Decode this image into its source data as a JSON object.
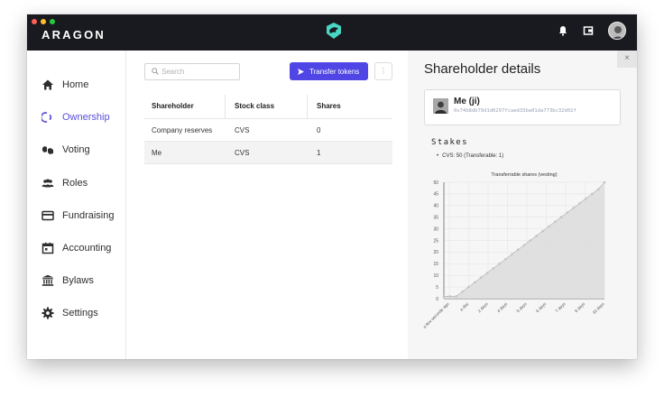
{
  "app": {
    "logo_text": "ARAGON",
    "traffic_colors": [
      "#ff5f56",
      "#ffbd2e",
      "#27c93f"
    ]
  },
  "sidebar": {
    "items": [
      {
        "label": "Home",
        "icon": "home-icon"
      },
      {
        "label": "Ownership",
        "icon": "ownership-icon",
        "active": true
      },
      {
        "label": "Voting",
        "icon": "voting-icon"
      },
      {
        "label": "Roles",
        "icon": "roles-icon"
      },
      {
        "label": "Fundraising",
        "icon": "fundraising-icon"
      },
      {
        "label": "Accounting",
        "icon": "accounting-icon"
      },
      {
        "label": "Bylaws",
        "icon": "bylaws-icon"
      },
      {
        "label": "Settings",
        "icon": "settings-icon"
      }
    ],
    "accent": "#5a4fd8"
  },
  "toolbar": {
    "search_placeholder": "Search",
    "transfer_label": "Transfer tokens",
    "more_label": "⋮"
  },
  "table": {
    "headers": [
      "Shareholder",
      "Stock class",
      "Shares"
    ],
    "rows": [
      [
        "Company reserves",
        "CVS",
        "0"
      ],
      [
        "Me",
        "CVS",
        "1"
      ]
    ]
  },
  "panel": {
    "title": "Shareholder details",
    "close_label": "×",
    "identity": {
      "name": "Me (ji)",
      "address": "0x74b8db79d1d0297fcaed33ba01da773bc32d02f"
    },
    "stakes_title": "Stakes",
    "stakes": [
      "CVS: 50 (Transferable: 1)"
    ]
  },
  "chart_data": {
    "type": "area",
    "title": "Transferrable shares (vesting)",
    "xlabel": "",
    "ylabel": "",
    "categories": [
      "a few seconds ago",
      "a day",
      "2 days",
      "4 days",
      "5 days",
      "6 days",
      "7 days",
      "9 days",
      "10 days"
    ],
    "x": [
      0,
      0.5,
      1,
      1.5,
      2,
      2.5,
      3,
      3.5,
      4,
      4.5,
      5,
      5.5,
      6,
      6.5,
      7,
      7.5,
      8,
      8.5,
      9,
      9.5,
      10,
      10.5,
      11,
      11.5,
      12,
      12.5,
      13
    ],
    "values": [
      1,
      1,
      1,
      3,
      5,
      7,
      9,
      11,
      13,
      15,
      17,
      19,
      21,
      23,
      25,
      27,
      29,
      31,
      33,
      35,
      37,
      39,
      41,
      43,
      45,
      47,
      50
    ],
    "ylim": [
      0,
      50
    ],
    "yticks": [
      0,
      5,
      10,
      15,
      20,
      25,
      30,
      35,
      40,
      45,
      50
    ],
    "grid": true,
    "fill_color": "#dedede",
    "line_color": "#bdbdbd"
  }
}
